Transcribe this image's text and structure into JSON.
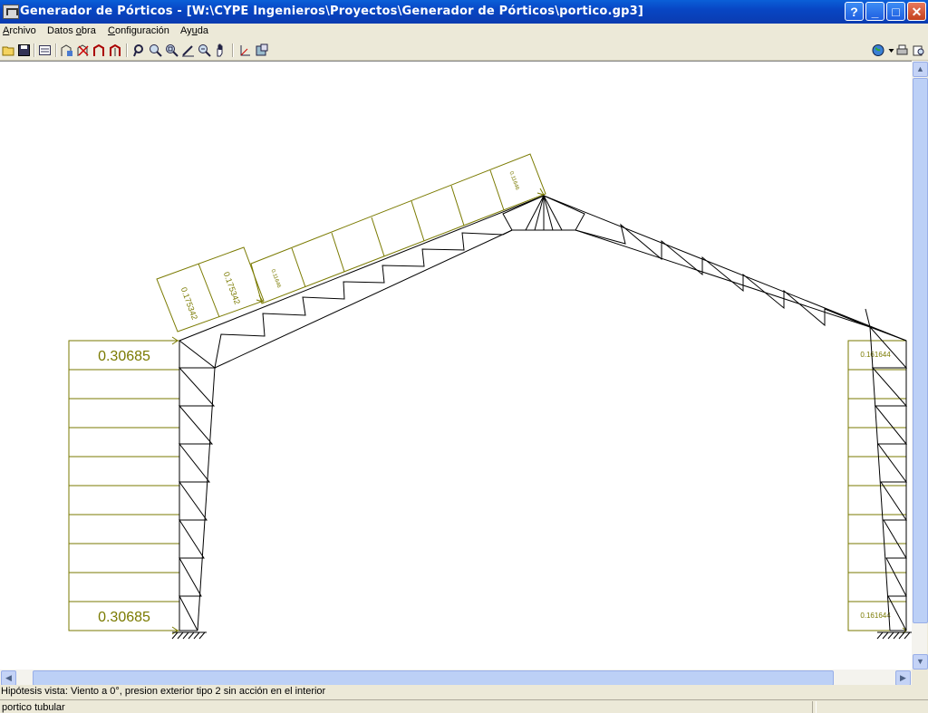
{
  "window": {
    "title": "Generador de Pórticos - [W:\\CYPE Ingenieros\\Proyectos\\Generador de Pórticos\\portico.gp3]",
    "buttons": {
      "help": "?",
      "minimize": "_",
      "maximize": "□",
      "close": "✕"
    }
  },
  "menu": [
    {
      "label": "Archivo",
      "underline": "A",
      "rest": "rchivo"
    },
    {
      "label": "Datos obra",
      "underline": "",
      "rest": ""
    },
    {
      "label": "Configuración",
      "underline": "",
      "rest": ""
    },
    {
      "label": "Ayuda",
      "underline": "",
      "rest": ""
    }
  ],
  "menu_labels": {
    "archivo": "Archivo",
    "datos_obra_pre": "Datos ",
    "datos_obra_u": "o",
    "datos_obra_post": "bra",
    "config_u": "C",
    "config_post": "onfiguración",
    "ayuda_pre": "Ay",
    "ayuda_u": "u",
    "ayuda_post": "da",
    "archivo_u": "A",
    "archivo_post": "rchivo"
  },
  "toolbar_icons": [
    "open-icon",
    "save-icon",
    "properties-icon",
    "frame-icon",
    "delete-frame-icon",
    "edit-frame-icon",
    "loads-icon",
    "redraw-icon",
    "zoom-window-icon",
    "zoom-extents-icon",
    "zoom-icon",
    "pencil-icon",
    "zoom-out-icon",
    "pan-hand-icon",
    "axes-icon",
    "export-icon",
    "globe-icon",
    "print-icon",
    "preview-icon"
  ],
  "drawing": {
    "left_wind_top": "0.30685",
    "left_wind_bottom": "0.30685",
    "right_wind_top": "0.161644",
    "right_wind_bottom": "0.161644",
    "roof_load_1": "0.175342",
    "roof_load_2": "0.175342",
    "roof_load_3": "0.11646",
    "roof_load_4": "0.11646",
    "line_color": "#7a7a00"
  },
  "status": {
    "hypothesis": "Hipótesis vista: Viento a 0°, presion exterior tipo 2 sin acción en el interior",
    "bottom": "portico tubular"
  }
}
